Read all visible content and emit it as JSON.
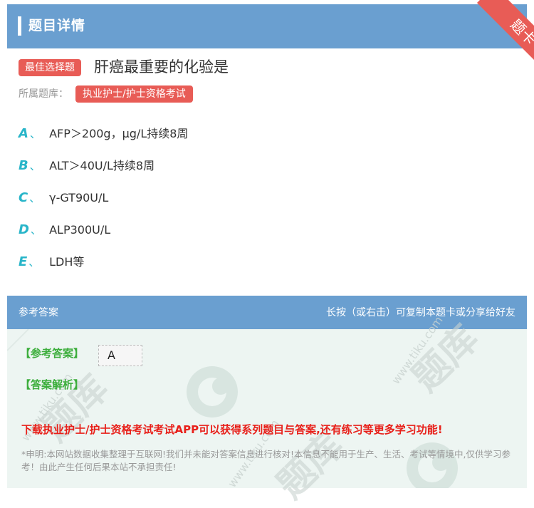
{
  "header": {
    "title": "题目详情",
    "ribbon": "题卡"
  },
  "question": {
    "type_tag": "最佳选择题",
    "title": "肝癌最重要的化验是",
    "bank_label": "所属题库：",
    "bank_name": "执业护士/护士资格考试",
    "options": [
      {
        "letter": "A",
        "sep": "、",
        "text": "AFP＞200g，μg/L持续8周"
      },
      {
        "letter": "B",
        "sep": "、",
        "text": "ALT＞40U/L持续8周"
      },
      {
        "letter": "C",
        "sep": "、",
        "text": "γ-GT90U/L"
      },
      {
        "letter": "D",
        "sep": "、",
        "text": "ALP300U/L"
      },
      {
        "letter": "E",
        "sep": "、",
        "text": "LDH等"
      }
    ]
  },
  "answer_section": {
    "title": "参考答案",
    "hint": "长按（或右击）可复制本题卡或分享给好友",
    "answer_label": "【参考答案】",
    "answer_value": "A",
    "explanation_label": "【答案解析】",
    "promo": "下载执业护士/护士资格考试考试APP可以获得系列题目与答案,还有练习等更多学习功能!",
    "disclaimer": "*申明:本网站数据收集整理于互联网!我们并未能对答案信息进行核对!本信息不能用于生产、生活、考试等情境中,仅供学习参考！由此产生任何后果本站不承担责任!"
  },
  "watermark": {
    "brand": "题库",
    "site": "www.tiku.com"
  },
  "colors": {
    "header_blue": "#6a9fd0",
    "tag_red": "#e85c56",
    "option_letter": "#29b5c9",
    "answer_green": "#3cae3c",
    "promo_red": "#e8201a",
    "answer_bg": "#edf5f2"
  }
}
